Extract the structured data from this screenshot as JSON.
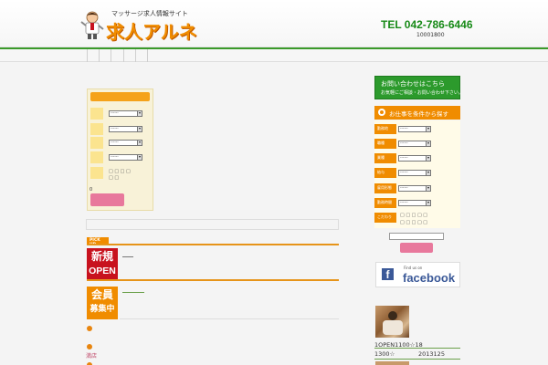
{
  "header": {
    "tagline": "マッサージ求人情報サイト",
    "brand": "求人アルネ",
    "tel": "TEL 042-786-6446",
    "tel_sub": "10001800"
  },
  "search": {
    "rows": [
      {
        "value": "------"
      },
      {
        "value": "------"
      },
      {
        "value": "------"
      },
      {
        "value": "------"
      }
    ],
    "checks": "□ □   □   □",
    "checks2": "□ □",
    "dot_label": "0"
  },
  "pickup": {
    "tag": "PICK UP",
    "banner1_top": "新規",
    "banner1_bottom": "OPEN",
    "banner2_top": "会員",
    "banner2_bottom": "募集中",
    "small_link": "満店"
  },
  "sidebar": {
    "contact_title": "お問い合わせはこちら",
    "contact_sub": "お気軽にご相談・お問い合わせ下さい。",
    "search_title": "お仕事を条件から探す",
    "rows": [
      {
        "label": "勤務地",
        "value": "------"
      },
      {
        "label": "職種",
        "value": "------"
      },
      {
        "label": "業種",
        "value": "------"
      },
      {
        "label": "給与",
        "value": "------"
      },
      {
        "label": "雇用形態",
        "value": "------"
      },
      {
        "label": "勤務時間",
        "value": "------"
      }
    ],
    "features_label": "こだわり",
    "features": "□  □  □  □  □",
    "fb_find": "Find us on",
    "fb_word": "facebook",
    "fb_letter": "f",
    "news1": "1OPEN1100☆18",
    "news2_left": "1300☆",
    "news2_right": "2013125"
  },
  "colors": {
    "brand_orange": "#f08c00",
    "brand_green": "#178a17",
    "pink": "#e8789c",
    "facebook": "#3b5998"
  }
}
